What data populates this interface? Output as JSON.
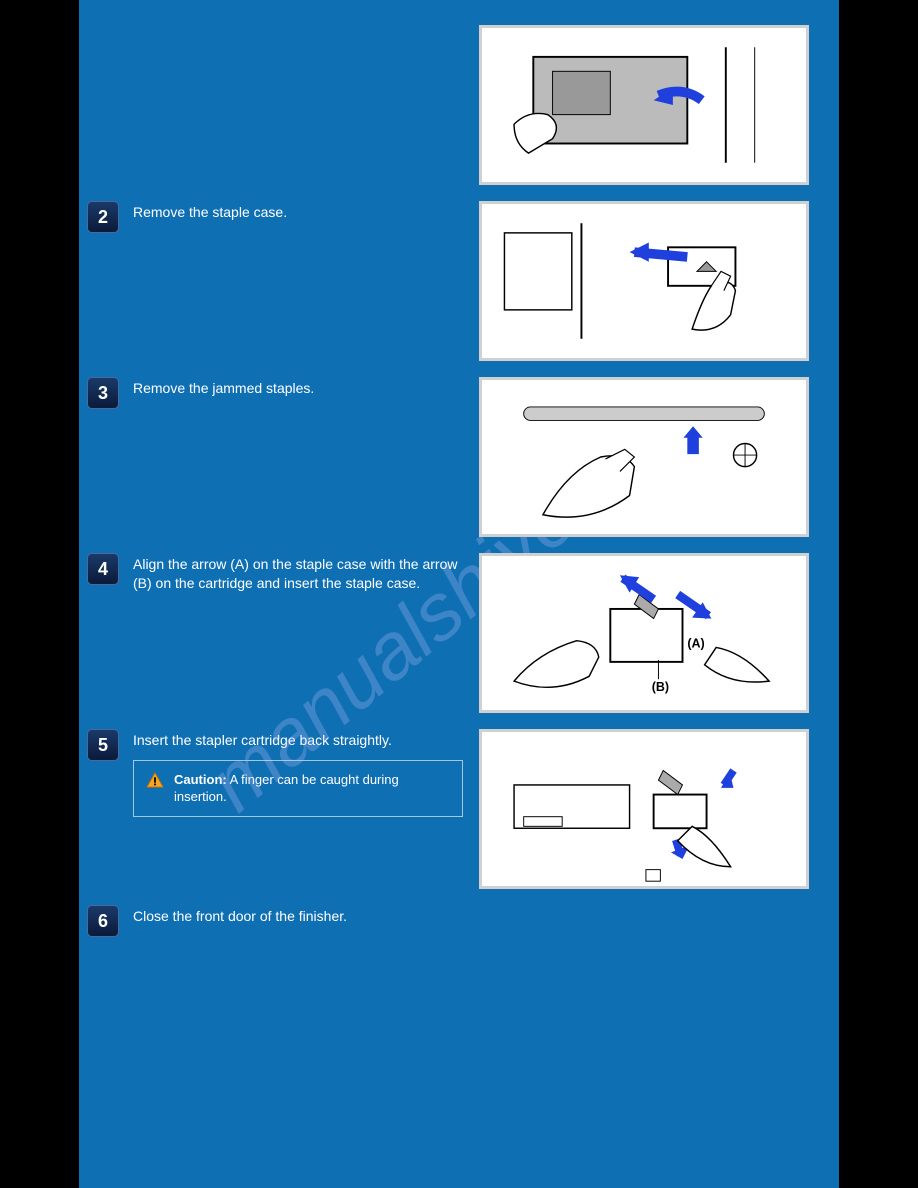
{
  "watermark": "manualshive.com",
  "steps": [
    {
      "num": " ",
      "text": "",
      "image": true
    },
    {
      "num": "2",
      "text": "Remove the staple case.",
      "image": true
    },
    {
      "num": "3",
      "text": "Remove the jammed staples.",
      "image": true
    },
    {
      "num": "4",
      "text": "Align the arrow (A) on the staple case with the arrow (B) on the cartridge and insert the staple case.",
      "image": true
    },
    {
      "num": "5",
      "text": "Insert the stapler cartridge back straightly.",
      "image": true,
      "caution": {
        "title": "Caution:",
        "body": " A finger can be caught during insertion."
      }
    },
    {
      "num": "6",
      "text": "Close the front door of the finisher.",
      "image": false
    }
  ]
}
